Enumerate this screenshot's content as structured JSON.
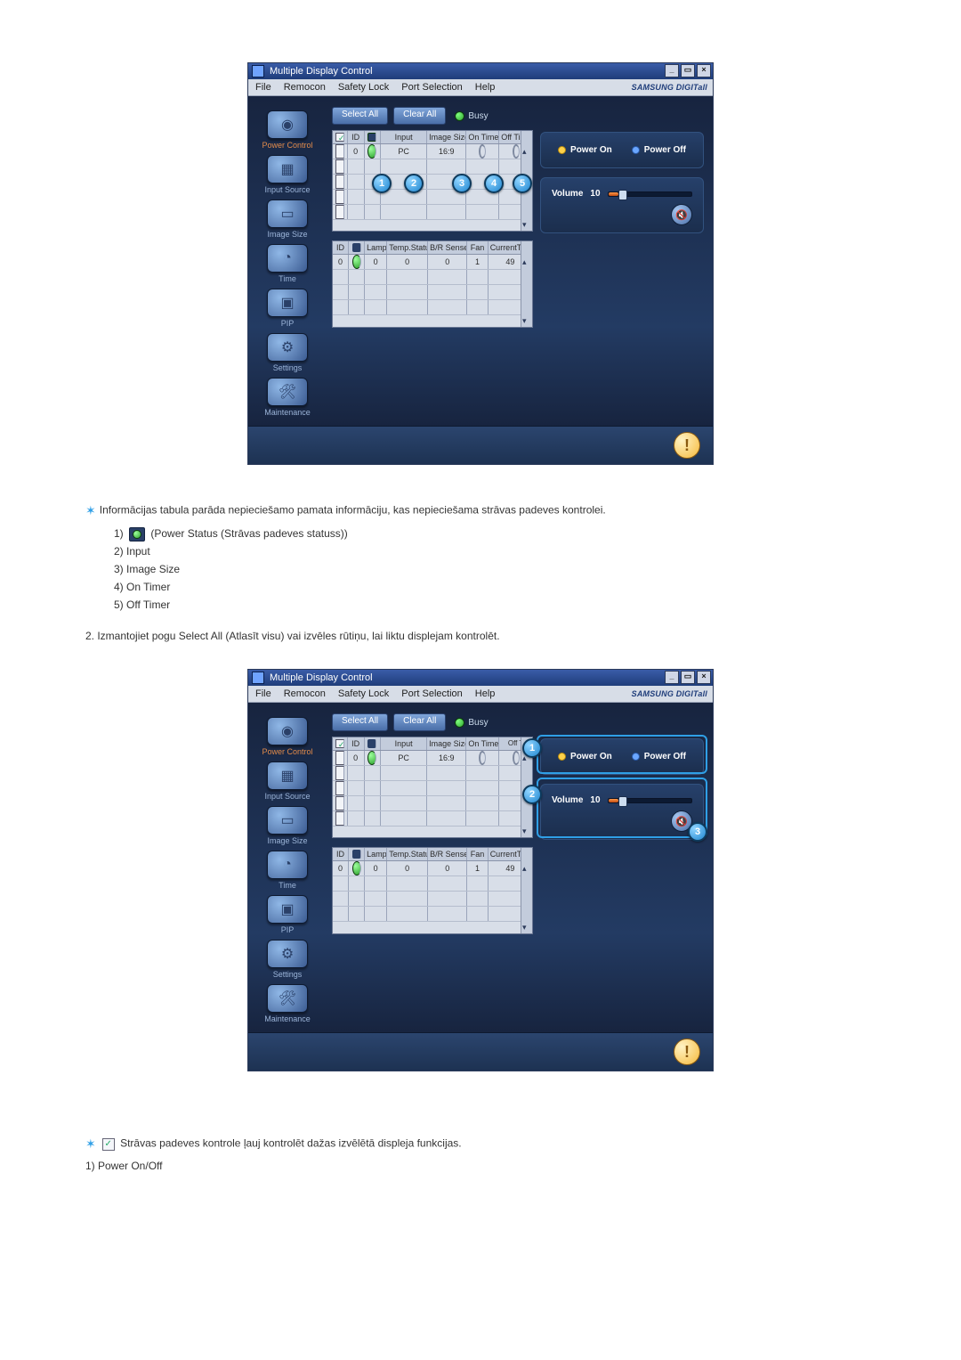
{
  "app": {
    "title": "Multiple Display Control",
    "brand": "SAMSUNG DIGITall",
    "menu": {
      "file": "File",
      "remocon": "Remocon",
      "safety": "Safety Lock",
      "port": "Port Selection",
      "help": "Help"
    },
    "toolbar": {
      "select_all": "Select All",
      "clear_all": "Clear All",
      "busy": "Busy"
    },
    "sidebar": {
      "power": "Power Control",
      "input": "Input Source",
      "image": "Image Size",
      "time": "Time",
      "pip": "PIP",
      "settings": "Settings",
      "maint": "Maintenance"
    },
    "grid1": {
      "headers": {
        "id": "ID",
        "input": "Input",
        "imsize": "Image Size",
        "ontimer": "On Timer",
        "offtimer": "Off Timer"
      },
      "row": {
        "id": "0",
        "input": "PC",
        "imsize": "16:9"
      }
    },
    "grid2": {
      "headers": {
        "id": "ID",
        "lamp": "Lamp",
        "temp": "Temp.Status",
        "brs": "B/R Senser",
        "fan": "Fan",
        "ct": "CurrentTemp."
      },
      "row": {
        "id": "0",
        "lamp": "0",
        "temp": "0",
        "brs": "0",
        "fan": "1",
        "ct": "49"
      }
    },
    "right": {
      "power_on": "Power On",
      "power_off": "Power Off",
      "volume_label": "Volume",
      "volume_value": "10"
    }
  },
  "content": {
    "star1": "Informācijas tabula parāda nepieciešamo pamata informāciju, kas nepieciešama strāvas padeves kontrolei.",
    "l1a": "1) ",
    "l1b": " (Power Status (Strāvas padeves statuss))",
    "l2": "2) Input",
    "l3": "3) Image Size",
    "l4": "4) On Timer",
    "l5": "5) Off Timer",
    "step2": "2.  Izmantojiet pogu Select All (Atlasīt visu) vai izvēles rūtiņu, lai liktu displejam kontrolēt.",
    "star2": " Strāvas padeves kontrole ļauj kontrolēt dažas izvēlētā displeja funkcijas.",
    "bottom1": "1) Power On/Off"
  }
}
